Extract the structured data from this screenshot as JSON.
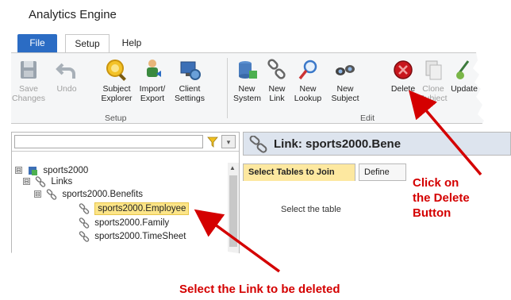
{
  "app": {
    "title": "Analytics Engine"
  },
  "tabs": [
    {
      "label": "File"
    },
    {
      "label": "Setup"
    },
    {
      "label": "Help"
    }
  ],
  "ribbon": {
    "buttons": [
      {
        "line1": "Save",
        "line2": "Changes",
        "icon": "save-icon",
        "disabled": true
      },
      {
        "line1": "Undo",
        "line2": "",
        "icon": "undo-icon",
        "disabled": true
      },
      {
        "line1": "Subject",
        "line2": "Explorer",
        "icon": "subject-explorer-icon",
        "disabled": false
      },
      {
        "line1": "Import/",
        "line2": "Export",
        "icon": "import-export-icon",
        "disabled": false
      },
      {
        "line1": "Client",
        "line2": "Settings",
        "icon": "client-settings-icon",
        "disabled": false
      },
      {
        "line1": "New",
        "line2": "System",
        "icon": "new-system-icon",
        "disabled": false
      },
      {
        "line1": "New",
        "line2": "Link",
        "icon": "new-link-icon",
        "disabled": false
      },
      {
        "line1": "New",
        "line2": "Lookup",
        "icon": "new-lookup-icon",
        "disabled": false
      },
      {
        "line1": "New",
        "line2": "Subject",
        "icon": "new-subject-icon",
        "disabled": false
      },
      {
        "line1": "Delete",
        "line2": "",
        "icon": "delete-icon",
        "disabled": false
      },
      {
        "line1": "Clone",
        "line2": "Subject",
        "icon": "clone-subject-icon",
        "disabled": true
      },
      {
        "line1": "Update",
        "line2": "",
        "icon": "update-icon",
        "disabled": false
      }
    ],
    "groups": [
      {
        "label": "Setup"
      },
      {
        "label": "Edit"
      }
    ]
  },
  "explorer": {
    "search": {
      "value": "",
      "placeholder": ""
    },
    "tree": [
      {
        "label": "sports2000",
        "icon": "database-icon",
        "expander": "⊟"
      },
      {
        "label": "Links",
        "icon": "link-icon",
        "expander": "⊟"
      },
      {
        "label": "sports2000.Benefits",
        "icon": "link-icon",
        "expander": "⊟"
      },
      {
        "label": "sports2000.Employee",
        "icon": "link-icon",
        "selected": true
      },
      {
        "label": "sports2000.Family",
        "icon": "link-icon"
      },
      {
        "label": "sports2000.TimeSheet",
        "icon": "link-icon"
      }
    ]
  },
  "detail": {
    "title": "Link: sports2000.Bene",
    "tabs": [
      {
        "label": "Select Tables to Join"
      },
      {
        "label": "Define"
      }
    ],
    "body": "Select the table"
  },
  "annotations": {
    "delete_note": [
      "Click on",
      "the Delete",
      "Button"
    ],
    "select_note": "Select the Link to be deleted",
    "color": "#d40000"
  },
  "colors": {
    "file_tab": "#2b6cc4",
    "selection": "#fce588",
    "active_tab": "#fde8a0",
    "header": "#dde4ee"
  }
}
